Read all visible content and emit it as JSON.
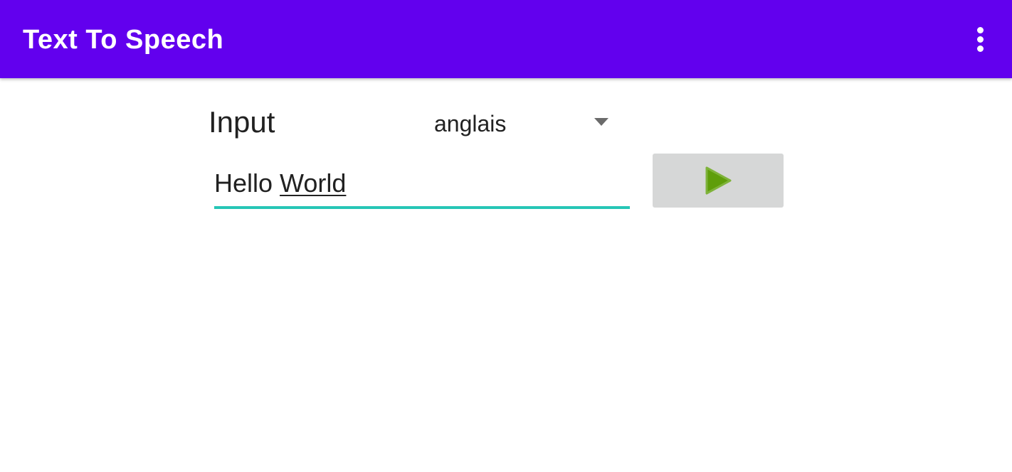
{
  "app_bar": {
    "title": "Text To Speech",
    "menu_icon": "more-vert-icon",
    "background_color": "#6200ee"
  },
  "main": {
    "input_label": "Input",
    "language_spinner": {
      "selected": "anglais",
      "arrow_icon": "dropdown-arrow-icon"
    },
    "text_field": {
      "value_part1": "Hello ",
      "value_part2": "World",
      "underline_color": "#26c6b6"
    },
    "play_button": {
      "icon": "play-icon",
      "icon_color": "#5f9e0a",
      "background_color": "#d6d7d7"
    }
  }
}
